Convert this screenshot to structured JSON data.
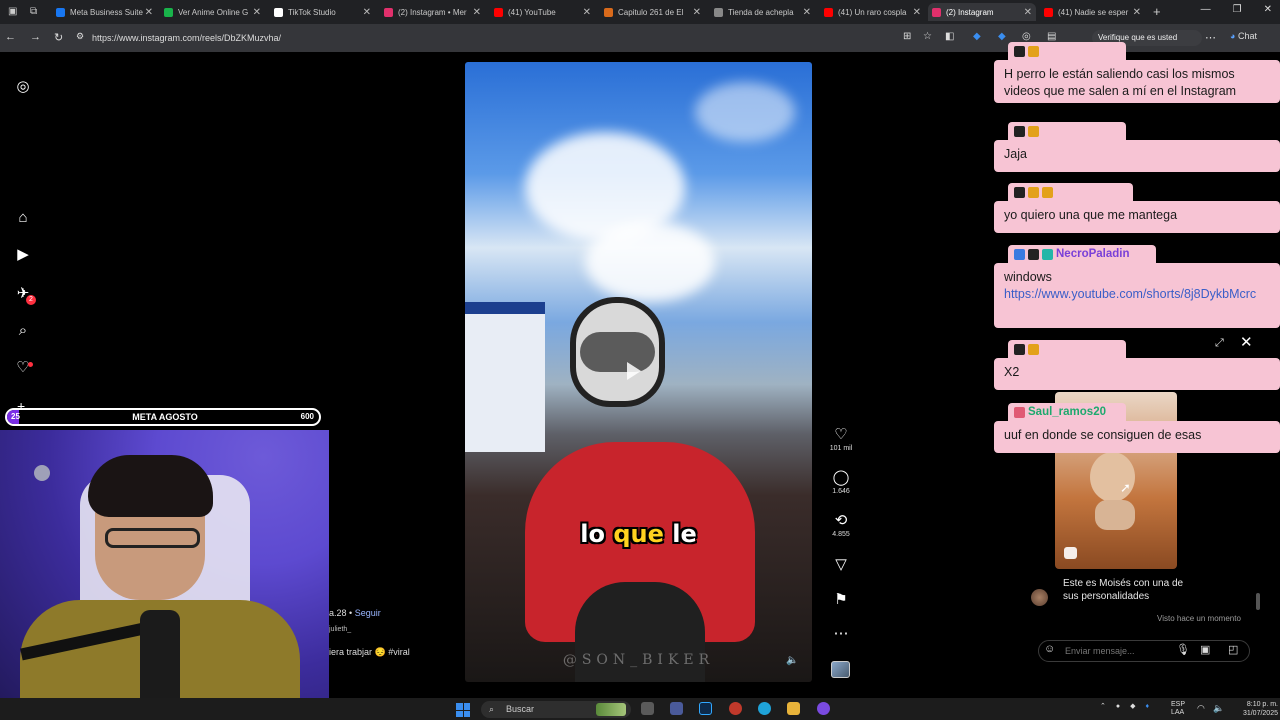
{
  "browser": {
    "tabs": [
      {
        "label": "Meta Business Suite",
        "color": "#1877f2"
      },
      {
        "label": "Ver Anime Online G",
        "color": "#19b34a"
      },
      {
        "label": "TikTok Studio",
        "color": "#ffffff"
      },
      {
        "label": "(2) Instagram • Mer",
        "color": "#e1306c"
      },
      {
        "label": "(41) YouTube",
        "color": "#ff0000"
      },
      {
        "label": "Capitulo 261 de El",
        "color": "#d96a1b"
      },
      {
        "label": "Tienda de achepla",
        "color": "#888888"
      },
      {
        "label": "(41) Un raro cospla",
        "color": "#ff0000"
      },
      {
        "label": "(2) Instagram",
        "color": "#e1306c"
      },
      {
        "label": "(41) Nadie se esper",
        "color": "#ff0000"
      }
    ],
    "url": "https://www.instagram.com/reels/DbZKMuzvha/",
    "verify_label": "Verifique que es usted",
    "chat_label": "Chat"
  },
  "reel": {
    "caption_white_1": "lo",
    "caption_yellow": "que",
    "caption_white_2": "le",
    "watermark": "@SON_BIKER",
    "likes": "101 mil",
    "comments": "1.646",
    "reposts": "4.855",
    "user_snippet": "a.28",
    "follow_label": "Seguir",
    "user_sub": "julieth_",
    "description": "iera trabjar 😔 #viral"
  },
  "stream": {
    "goal_label": "META AGOSTO",
    "goal_current": "25",
    "goal_target": "600",
    "goal_progress": 0.04,
    "goal_color": "#7a2ee6"
  },
  "chat": [
    {
      "user": "",
      "text": "H perro le están saliendo casi los mismos videos que me salen a mí en el Instagram"
    },
    {
      "user": "",
      "text": "Jaja"
    },
    {
      "user": "",
      "text": "yo quiero una que me mantega"
    },
    {
      "user": "NecroPaladin",
      "text": "windows",
      "link": "https://www.youtube.com/shorts/8j8DykbMcrc"
    },
    {
      "user": "",
      "text": "X2"
    },
    {
      "user": "Saul_ramos20",
      "text": "uuf en donde se consiguen de esas"
    }
  ],
  "dm": {
    "message": "Este es Moisés con una de sus personalidades",
    "seen": "Visto hace un momento",
    "input_placeholder": "Enviar mensaje..."
  },
  "taskbar": {
    "search_label": "Buscar",
    "lang_1": "ESP",
    "lang_2": "LAA",
    "time": "8:10 p. m.",
    "date": "31/07/2025"
  }
}
